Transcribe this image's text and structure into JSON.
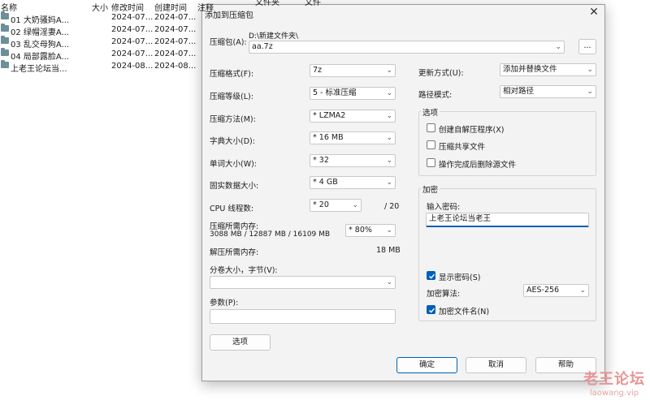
{
  "explorer": {
    "headers": {
      "name": "名称",
      "size": "大小",
      "modified": "修改时间",
      "created": "创建时间",
      "notes": "注释",
      "folders": "文件夹",
      "files": "文件"
    },
    "rows": [
      {
        "name": "01 大奶骚妈A...",
        "modified": "2024-07...",
        "created": "2024-07..."
      },
      {
        "name": "02 绿帽淫妻A...",
        "modified": "2024-07...",
        "created": "2024-07..."
      },
      {
        "name": "03 乱交母狗A...",
        "modified": "2024-07...",
        "created": "2024-07..."
      },
      {
        "name": "04 局部露脸A...",
        "modified": "2024-07...",
        "created": "2024-07..."
      },
      {
        "name": "上老王论坛当...",
        "modified": "2024-08...",
        "created": "2024-08..."
      }
    ]
  },
  "dialog": {
    "title": "添加到压缩包",
    "archive": {
      "label": "压缩包(A):",
      "path": "D:\\新建文件夹\\",
      "value": "aa.7z",
      "browse": "..."
    },
    "format": {
      "label": "压缩格式(F):",
      "value": "7z"
    },
    "level": {
      "label": "压缩等级(L):",
      "value": "5 - 标准压缩"
    },
    "method": {
      "label": "压缩方法(M):",
      "value": "* LZMA2"
    },
    "dict": {
      "label": "字典大小(D):",
      "value": "* 16 MB"
    },
    "word": {
      "label": "单词大小(W):",
      "value": "* 32"
    },
    "solid": {
      "label": "固实数据大小:",
      "value": "* 4 GB"
    },
    "cpu": {
      "label": "CPU 线程数:",
      "value": "* 20",
      "max": "/ 20"
    },
    "memory": {
      "label": "压缩所需内存:",
      "value": "3088 MB / 12887 MB / 16109 MB",
      "percent": "* 80%"
    },
    "decompress_memory": {
      "label": "解压所需内存:",
      "value": "18 MB"
    },
    "split": {
      "label": "分卷大小，字节(V):",
      "value": ""
    },
    "params": {
      "label": "参数(P):",
      "value": ""
    },
    "update": {
      "label": "更新方式(U):",
      "value": "添加并替换文件"
    },
    "path_mode": {
      "label": "路径模式:",
      "value": "相对路径"
    },
    "options": {
      "title": "选项",
      "sfx": {
        "label": "创建自解压程序(X)",
        "checked": false
      },
      "shared": {
        "label": "压缩共享文件",
        "checked": false
      },
      "delete": {
        "label": "操作完成后删除源文件",
        "checked": false
      }
    },
    "encryption": {
      "title": "加密",
      "password_label": "输入密码:",
      "password_value": "上老王论坛当老王",
      "show_password": {
        "label": "显示密码(S)",
        "checked": true
      },
      "method_label": "加密算法:",
      "method_value": "AES-256",
      "encrypt_names": {
        "label": "加密文件名(N)",
        "checked": true
      }
    },
    "buttons": {
      "options": "选项",
      "ok": "确定",
      "cancel": "取消",
      "help": "帮助"
    }
  },
  "watermark": {
    "line1": "老王论坛",
    "line2": "laowang.vip"
  }
}
